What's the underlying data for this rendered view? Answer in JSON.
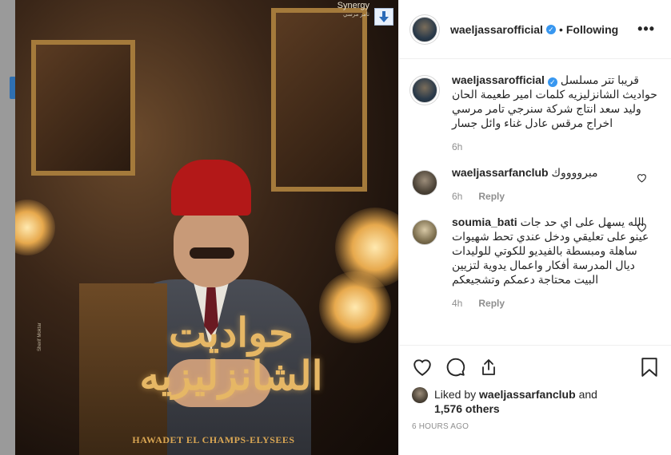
{
  "post": {
    "username": "waeljassarofficial",
    "separator": "•",
    "follow_status": "Following",
    "more_glyph": "•••",
    "media": {
      "brand": "Synergy",
      "brand_sub": "تامر مرسي",
      "title_ar": "حواديت الشانزليزيه",
      "title_en": "HAWADET EL CHAMPS-ELYSEES",
      "credit": "Sherif Moktar"
    }
  },
  "comments": [
    {
      "username": "waeljassarofficial",
      "verified": true,
      "text": "قريبا تتر مسلسل حواديث الشانزليزيه كلمات امير طعيمة الحان وليد سعد انتاج شركة سنرجي تامر مرسي اخراج مرقس عادل غناء وائل جسار",
      "time": "6h",
      "reply": ""
    },
    {
      "username": "waeljassarfanclub",
      "verified": false,
      "text": "مبرووووك",
      "time": "6h",
      "reply": "Reply"
    },
    {
      "username": "soumia_bati",
      "verified": false,
      "text": "الله يسهل على اي حد جات عينو على تعليقي ودخل عندي تحط شهيوات ساهلة ومبسطة بالفيديو للكوتي للوليدات ديال المدرسة أفكار واعمال يدوية لتزيين البيت محتاجة دعمكم وتشجيعكم",
      "time": "4h",
      "reply": "Reply"
    }
  ],
  "likes": {
    "prefix": "Liked by",
    "liker": "waeljassarfanclub",
    "conj": "and",
    "others": "1,576 others"
  },
  "posted_ago": "6 HOURS AGO",
  "icons": {
    "like": "heart-icon",
    "comment": "comment-icon",
    "share": "share-icon",
    "save": "bookmark-icon",
    "download": "download-arrow-icon"
  },
  "colors": {
    "verified": "#3897f0",
    "text": "#262626",
    "muted": "#8e8e8e"
  }
}
